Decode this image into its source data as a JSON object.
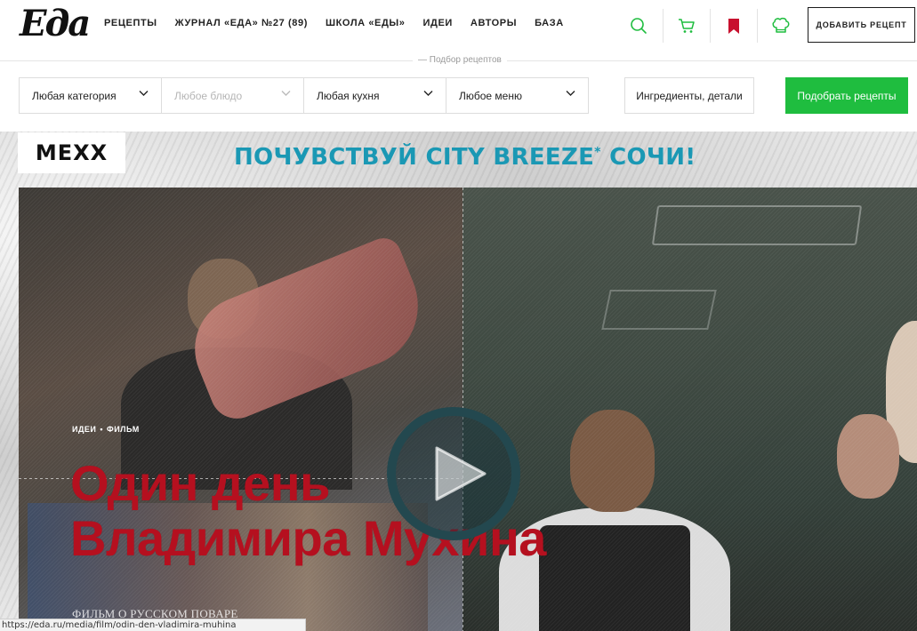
{
  "header": {
    "logo": "Еда",
    "nav": [
      "РЕЦЕПТЫ",
      "ЖУРНАЛ «ЕДА» №27 (89)",
      "ШКОЛА «ЕДЫ»",
      "ИДЕИ",
      "АВТОРЫ",
      "БАЗА"
    ],
    "icons": [
      "search-icon",
      "cart-icon",
      "bookmark-icon",
      "chef-hat-icon"
    ],
    "add_recipe_label": "ДОБАВИТЬ РЕЦЕПТ"
  },
  "filters": {
    "caption": "— Подбор рецептов",
    "category": "Любая категория",
    "dish_placeholder": "Любое блюдо",
    "cuisine": "Любая кухня",
    "menu": "Любое меню",
    "ingredients_label": "Ингредиенты, детали",
    "submit_label": "Подобрать рецепты"
  },
  "banner": {
    "brand": "MEXX",
    "promo": "ПОЧУВСТВУЙ CITY BREEZE",
    "promo_mark": "*",
    "promo_tail": " СОЧИ!"
  },
  "feature": {
    "tag1": "ИДЕИ",
    "tag_separator": "•",
    "tag2": "ФИЛЬМ",
    "title_line1": "Один день",
    "title_line2": "Владимира Мухина",
    "subtitle": "ФИЛЬМ О РУССКОМ ПОВАРЕ"
  },
  "status": {
    "url": "https://eda.ru/media/film/odin-den-vladimira-muhina"
  },
  "colors": {
    "accent_green": "#1fbd3f",
    "headline_red": "#b5101f",
    "promo_blue": "#1a98b4",
    "bookmark_red": "#c8102e"
  }
}
